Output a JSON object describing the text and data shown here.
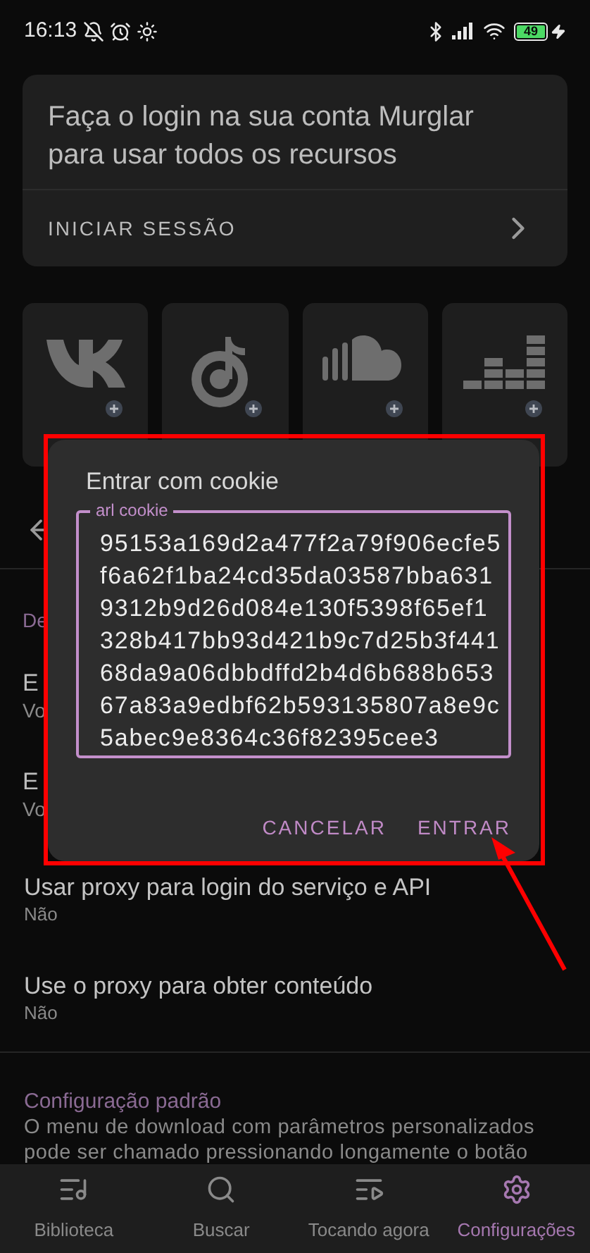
{
  "status_bar": {
    "time": "16:13",
    "battery": "49"
  },
  "login_card": {
    "message": "Faça o login na sua conta Murglar para usar todos os recursos",
    "action": "INICIAR SESSÃO"
  },
  "services": [
    {
      "kind": "vk"
    },
    {
      "kind": "note"
    },
    {
      "kind": "cloud"
    },
    {
      "kind": "bars"
    }
  ],
  "background_list": {
    "section_header": "De",
    "rows": [
      {
        "title": "E",
        "subtitle": "Vo"
      },
      {
        "title": "E",
        "subtitle": "Vo"
      }
    ]
  },
  "dialog": {
    "title": "Entrar com cookie",
    "field_label": "arl cookie",
    "field_value": "95153a169d2a477f2a79f906ecfe5f6a62f1ba24cd35da03587bba6319312b9d26d084e130f5398f65ef1328b417bb93d421b9c7d25b3f44168da9a06dbbdffd2b4d6b688b65367a83a9edbf62b593135807a8e9c5abec9e8364c36f82395cee3",
    "buttons": [
      "CANCELAR",
      "ENTRAR"
    ]
  },
  "settings": [
    {
      "title": "Usar proxy para login do serviço e API",
      "value": "Não"
    },
    {
      "title": "Use o proxy para obter conteúdo",
      "value": "Não"
    }
  ],
  "default_config": {
    "header": "Configuração padrão",
    "description": "O menu de download com parâmetros personalizados pode ser chamado pressionando longamente o botão"
  },
  "bottom_nav": [
    {
      "label": "Biblioteca",
      "selected": false
    },
    {
      "label": "Buscar",
      "selected": false
    },
    {
      "label": "Tocando agora",
      "selected": false
    },
    {
      "label": "Configurações",
      "selected": true
    }
  ]
}
